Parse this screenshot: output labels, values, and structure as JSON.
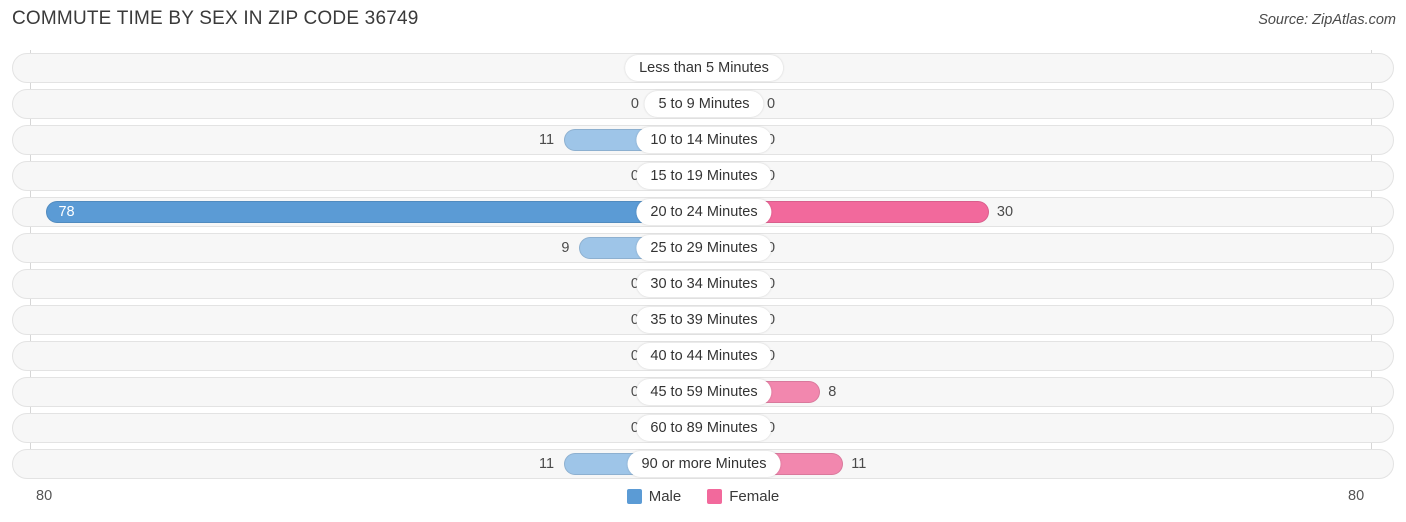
{
  "header": {
    "title": "COMMUTE TIME BY SEX IN ZIP CODE 36749",
    "source": "Source: ZipAtlas.com"
  },
  "legend": {
    "male_label": "Male",
    "female_label": "Female",
    "male_color": "#5B9BD5",
    "female_color": "#F2699C"
  },
  "axis": {
    "left_label": "80",
    "right_label": "80",
    "max": 80
  },
  "chart_data": {
    "type": "bar",
    "title": "COMMUTE TIME BY SEX IN ZIP CODE 36749",
    "xlabel": "",
    "ylabel": "",
    "orientation": "horizontal-diverging",
    "xlim": [
      80,
      80
    ],
    "grid": false,
    "legend_position": "bottom-center",
    "categories": [
      "Less than 5 Minutes",
      "5 to 9 Minutes",
      "10 to 14 Minutes",
      "15 to 19 Minutes",
      "20 to 24 Minutes",
      "25 to 29 Minutes",
      "30 to 34 Minutes",
      "35 to 39 Minutes",
      "40 to 44 Minutes",
      "45 to 59 Minutes",
      "60 to 89 Minutes",
      "90 or more Minutes"
    ],
    "series": [
      {
        "name": "Male",
        "values": [
          0,
          0,
          11,
          0,
          78,
          9,
          0,
          0,
          0,
          0,
          0,
          11
        ]
      },
      {
        "name": "Female",
        "values": [
          0,
          0,
          0,
          0,
          30,
          0,
          0,
          0,
          0,
          8,
          0,
          11
        ]
      }
    ]
  },
  "rows": [
    {
      "label": "Less than 5 Minutes",
      "male": "0",
      "female": "0",
      "male_value": 0,
      "female_value": 0
    },
    {
      "label": "5 to 9 Minutes",
      "male": "0",
      "female": "0",
      "male_value": 0,
      "female_value": 0
    },
    {
      "label": "10 to 14 Minutes",
      "male": "11",
      "female": "0",
      "male_value": 11,
      "female_value": 0
    },
    {
      "label": "15 to 19 Minutes",
      "male": "0",
      "female": "0",
      "male_value": 0,
      "female_value": 0
    },
    {
      "label": "20 to 24 Minutes",
      "male": "78",
      "female": "30",
      "male_value": 78,
      "female_value": 30
    },
    {
      "label": "25 to 29 Minutes",
      "male": "9",
      "female": "0",
      "male_value": 9,
      "female_value": 0
    },
    {
      "label": "30 to 34 Minutes",
      "male": "0",
      "female": "0",
      "male_value": 0,
      "female_value": 0
    },
    {
      "label": "35 to 39 Minutes",
      "male": "0",
      "female": "0",
      "male_value": 0,
      "female_value": 0
    },
    {
      "label": "40 to 44 Minutes",
      "male": "0",
      "female": "0",
      "male_value": 0,
      "female_value": 0
    },
    {
      "label": "45 to 59 Minutes",
      "male": "0",
      "female": "8",
      "male_value": 0,
      "female_value": 8
    },
    {
      "label": "60 to 89 Minutes",
      "male": "0",
      "female": "0",
      "male_value": 0,
      "female_value": 0
    },
    {
      "label": "90 or more Minutes",
      "male": "11",
      "female": "11",
      "male_value": 11,
      "female_value": 11
    }
  ]
}
